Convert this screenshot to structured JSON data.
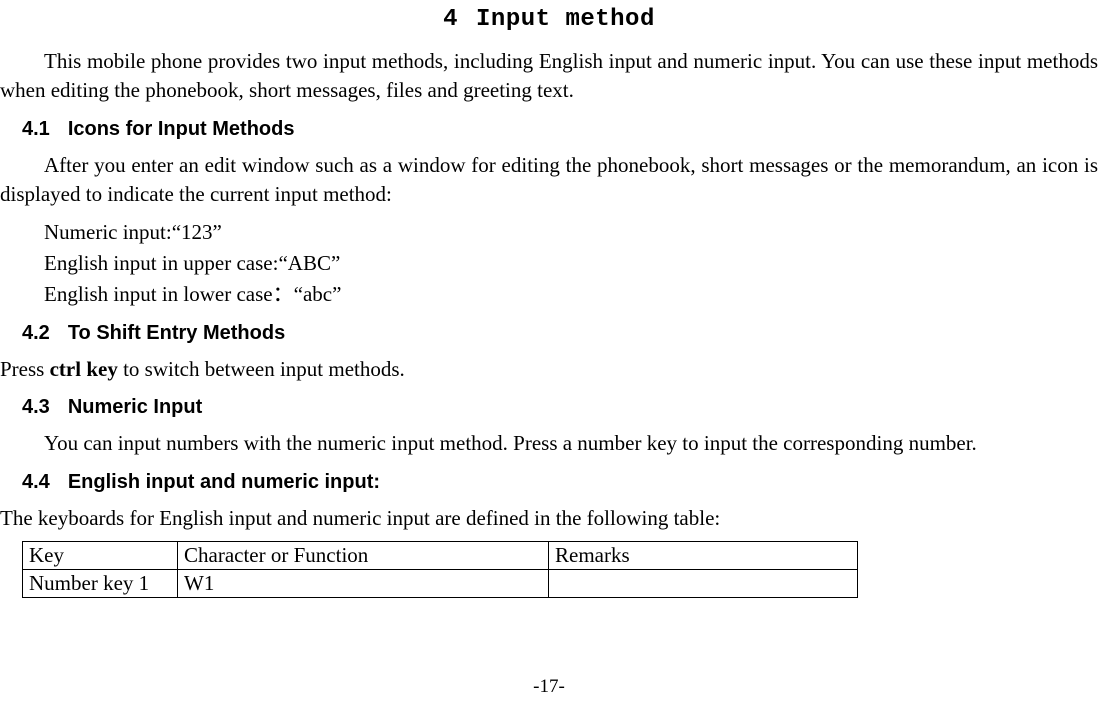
{
  "heading": {
    "num": "4",
    "title": "Input method"
  },
  "intro": "This mobile phone provides two input methods, including English input and numeric input. You can use these input methods when editing the phonebook, short messages, files and greeting text.",
  "s41": {
    "num": "4.1",
    "title": "Icons for Input Methods",
    "para": "After you enter an edit window such as a window for editing the phonebook, short messages or the memorandum, an icon is displayed to indicate the current input method:",
    "line1": "Numeric input:“123”",
    "line2": "English input in upper case:“ABC”",
    "line3": "English input in lower case：“abc”"
  },
  "s42": {
    "num": "4.2",
    "title": "To Shift Entry Methods",
    "pre": "Press ",
    "bold": "ctrl key",
    "post": " to switch between input methods."
  },
  "s43": {
    "num": "4.3",
    "title": "Numeric Input",
    "para": "You can input numbers with the numeric input method. Press a number key to input the corresponding number."
  },
  "s44": {
    "num": "4.4",
    "title": "English input and numeric input:",
    "para": "The keyboards for English input and numeric input are defined in the following table:",
    "table": {
      "header": {
        "c1": "Key",
        "c2": "Character or Function",
        "c3": "Remarks"
      },
      "row1": {
        "c1": "Number key 1",
        "c2": "W1",
        "c3": ""
      }
    }
  },
  "pagenum": "-17-"
}
